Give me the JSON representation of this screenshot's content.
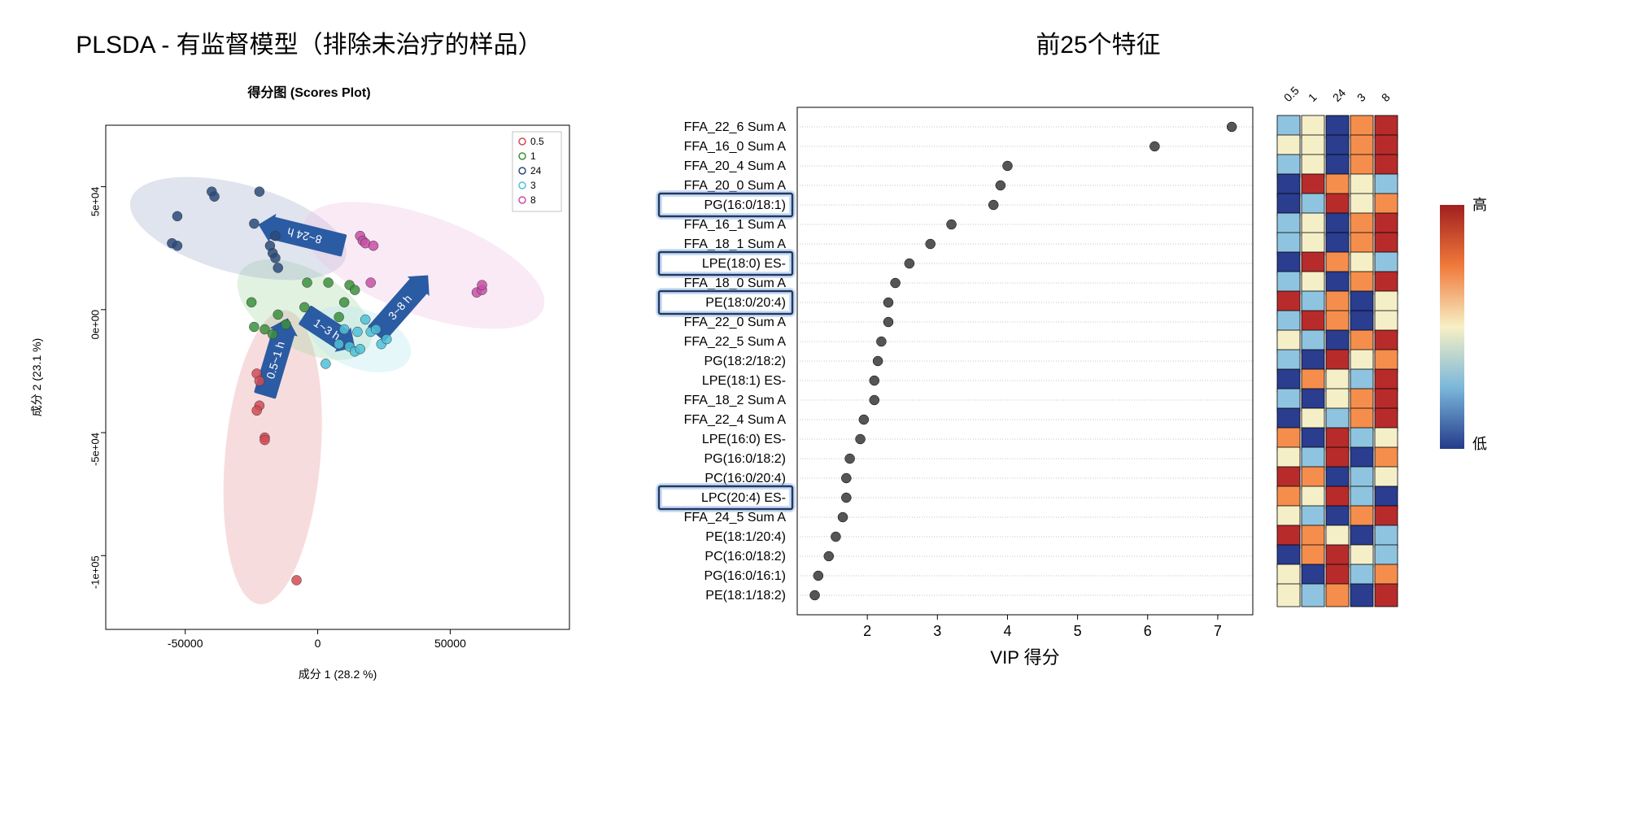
{
  "left": {
    "title": "PLSDA - 有监督模型（排除未治疗的样品）",
    "plot_title": "得分图 (Scores Plot)",
    "xlabel": "成分 1 (28.2 %)",
    "ylabel": "成分 2 (23.1 %)",
    "legend": [
      "0.5",
      "1",
      "24",
      "3",
      "8"
    ],
    "arrows": [
      "0.5~1 h",
      "1~3 h",
      "3~8 h",
      "8~24 h"
    ]
  },
  "right": {
    "title": "前25个特征",
    "xlabel": "VIP 得分",
    "heat_cols": [
      "0.5",
      "1",
      "24",
      "3",
      "8"
    ],
    "heat_high": "高",
    "heat_low": "低",
    "boxed_index": [
      4,
      7,
      9,
      19
    ]
  },
  "chart_data": [
    {
      "type": "scatter",
      "title": "得分图 (Scores Plot)",
      "xlabel": "成分 1 (28.2 %)",
      "ylabel": "成分 2 (23.1 %)",
      "xlim": [
        -80000,
        95000
      ],
      "ylim": [
        -130000,
        75000
      ],
      "xticks": [
        -50000,
        0,
        50000
      ],
      "yticks_labels": [
        "-1e+05",
        "-5e+04",
        "0e+00",
        "5e+04"
      ],
      "yticks": [
        -100000,
        -50000,
        0,
        50000
      ],
      "series": [
        {
          "name": "0.5",
          "color": "#d24b56",
          "points": [
            [
              -23000,
              -26000
            ],
            [
              -22000,
              -29000
            ],
            [
              -22000,
              -39000
            ],
            [
              -23000,
              -41000
            ],
            [
              -20000,
              -52000
            ],
            [
              -20000,
              -53000
            ],
            [
              -8000,
              -110000
            ]
          ]
        },
        {
          "name": "1",
          "color": "#3c8f3c",
          "points": [
            [
              -25000,
              3000
            ],
            [
              -24000,
              -7000
            ],
            [
              -20000,
              -8000
            ],
            [
              -17000,
              -10000
            ],
            [
              -15000,
              -2000
            ],
            [
              -12000,
              -6000
            ],
            [
              -5000,
              1000
            ],
            [
              -4000,
              11000
            ],
            [
              4000,
              11000
            ],
            [
              12000,
              10000
            ],
            [
              14000,
              8000
            ],
            [
              10000,
              3000
            ],
            [
              8000,
              -3000
            ]
          ]
        },
        {
          "name": "24",
          "color": "#2c4b7a",
          "points": [
            [
              -55000,
              27000
            ],
            [
              -53000,
              26000
            ],
            [
              -53000,
              38000
            ],
            [
              -40000,
              48000
            ],
            [
              -39000,
              46000
            ],
            [
              -22000,
              48000
            ],
            [
              -24000,
              35000
            ],
            [
              -18000,
              26000
            ],
            [
              -17000,
              23000
            ],
            [
              -16000,
              30000
            ],
            [
              -16000,
              21000
            ],
            [
              -15000,
              17000
            ]
          ]
        },
        {
          "name": "3",
          "color": "#4fc0d8",
          "points": [
            [
              3000,
              -22000
            ],
            [
              8000,
              -14000
            ],
            [
              10000,
              -8000
            ],
            [
              12000,
              -15000
            ],
            [
              14000,
              -17000
            ],
            [
              15000,
              -9000
            ],
            [
              16000,
              -16000
            ],
            [
              18000,
              -4000
            ],
            [
              20000,
              -9000
            ],
            [
              22000,
              -8000
            ],
            [
              24000,
              -14000
            ],
            [
              26000,
              -12000
            ]
          ]
        },
        {
          "name": "8",
          "color": "#c850a6",
          "points": [
            [
              16000,
              30000
            ],
            [
              17000,
              28000
            ],
            [
              18000,
              27000
            ],
            [
              21000,
              26000
            ],
            [
              20000,
              11000
            ],
            [
              60000,
              7000
            ],
            [
              62000,
              8000
            ],
            [
              62000,
              10000
            ]
          ]
        }
      ],
      "ellipses": [
        {
          "name": "0.5",
          "color": "#e99aa0",
          "cx": -17000,
          "cy": -60000,
          "rx": 18000,
          "ry": 60000,
          "angle": -5
        },
        {
          "name": "1",
          "color": "#a8d9a8",
          "cx": -5000,
          "cy": 0,
          "rx": 28000,
          "ry": 16000,
          "angle": -30
        },
        {
          "name": "24",
          "color": "#a3b2cf",
          "cx": -30000,
          "cy": 33000,
          "rx": 42000,
          "ry": 18000,
          "angle": -15
        },
        {
          "name": "3",
          "color": "#b8e8f0",
          "cx": 16000,
          "cy": -12000,
          "rx": 20000,
          "ry": 12000,
          "angle": -20
        },
        {
          "name": "8",
          "color": "#eec2e2",
          "cx": 40000,
          "cy": 18000,
          "rx": 48000,
          "ry": 20000,
          "angle": -20
        }
      ],
      "arrows": [
        {
          "label": "0.5~1 h",
          "x1": -20000,
          "y1": -35000,
          "x2": -12000,
          "y2": -6000
        },
        {
          "label": "1~3 h",
          "x1": -5000,
          "y1": -2000,
          "x2": 12000,
          "y2": -14000
        },
        {
          "label": "3~8 h",
          "x1": 22000,
          "y1": -10000,
          "x2": 40000,
          "y2": 12000
        },
        {
          "label": "8~24 h",
          "x1": 10000,
          "y1": 26000,
          "x2": -20000,
          "y2": 34000
        }
      ]
    },
    {
      "type": "dot-ranked",
      "xlabel": "VIP 得分",
      "xlim": [
        1,
        7.5
      ],
      "xticks": [
        2,
        3,
        4,
        5,
        6,
        7
      ],
      "features": [
        {
          "name": "FFA_22_6 Sum A",
          "vip": 7.2,
          "heat": [
            "lb",
            "cr",
            "db",
            "or",
            "rd"
          ]
        },
        {
          "name": "FFA_16_0 Sum A",
          "vip": 6.1,
          "heat": [
            "cr",
            "cr",
            "db",
            "or",
            "rd"
          ]
        },
        {
          "name": "FFA_20_4 Sum A",
          "vip": 4.0,
          "heat": [
            "lb",
            "cr",
            "db",
            "or",
            "rd"
          ]
        },
        {
          "name": "FFA_20_0 Sum A",
          "vip": 3.9,
          "heat": [
            "db",
            "rd",
            "or",
            "cr",
            "lb"
          ]
        },
        {
          "name": "PG(16:0/18:1)",
          "vip": 3.8,
          "heat": [
            "db",
            "lb",
            "rd",
            "cr",
            "or"
          ]
        },
        {
          "name": "FFA_16_1 Sum A",
          "vip": 3.2,
          "heat": [
            "lb",
            "cr",
            "db",
            "or",
            "rd"
          ]
        },
        {
          "name": "FFA_18_1 Sum A",
          "vip": 2.9,
          "heat": [
            "lb",
            "cr",
            "db",
            "or",
            "rd"
          ]
        },
        {
          "name": "LPE(18:0) ES-",
          "vip": 2.6,
          "heat": [
            "db",
            "rd",
            "or",
            "cr",
            "lb"
          ]
        },
        {
          "name": "FFA_18_0 Sum A",
          "vip": 2.4,
          "heat": [
            "lb",
            "cr",
            "db",
            "or",
            "rd"
          ]
        },
        {
          "name": "PE(18:0/20:4)",
          "vip": 2.3,
          "heat": [
            "rd",
            "lb",
            "or",
            "db",
            "cr"
          ]
        },
        {
          "name": "FFA_22_0 Sum A",
          "vip": 2.3,
          "heat": [
            "lb",
            "rd",
            "or",
            "db",
            "cr"
          ]
        },
        {
          "name": "FFA_22_5 Sum A",
          "vip": 2.2,
          "heat": [
            "cr",
            "lb",
            "db",
            "or",
            "rd"
          ]
        },
        {
          "name": "PG(18:2/18:2)",
          "vip": 2.15,
          "heat": [
            "lb",
            "db",
            "rd",
            "cr",
            "or"
          ]
        },
        {
          "name": "LPE(18:1) ES-",
          "vip": 2.1,
          "heat": [
            "db",
            "or",
            "cr",
            "lb",
            "rd"
          ]
        },
        {
          "name": "FFA_18_2 Sum A",
          "vip": 2.1,
          "heat": [
            "lb",
            "db",
            "cr",
            "or",
            "rd"
          ]
        },
        {
          "name": "FFA_22_4 Sum A",
          "vip": 1.95,
          "heat": [
            "db",
            "cr",
            "lb",
            "or",
            "rd"
          ]
        },
        {
          "name": "LPE(16:0) ES-",
          "vip": 1.9,
          "heat": [
            "or",
            "db",
            "rd",
            "lb",
            "cr"
          ]
        },
        {
          "name": "PG(16:0/18:2)",
          "vip": 1.75,
          "heat": [
            "cr",
            "lb",
            "rd",
            "db",
            "or"
          ]
        },
        {
          "name": "PC(16:0/20:4)",
          "vip": 1.7,
          "heat": [
            "rd",
            "or",
            "db",
            "lb",
            "cr"
          ]
        },
        {
          "name": "LPC(20:4) ES-",
          "vip": 1.7,
          "heat": [
            "or",
            "cr",
            "rd",
            "lb",
            "db"
          ]
        },
        {
          "name": "FFA_24_5 Sum A",
          "vip": 1.65,
          "heat": [
            "cr",
            "lb",
            "db",
            "or",
            "rd"
          ]
        },
        {
          "name": "PE(18:1/20:4)",
          "vip": 1.55,
          "heat": [
            "rd",
            "or",
            "cr",
            "db",
            "lb"
          ]
        },
        {
          "name": "PC(16:0/18:2)",
          "vip": 1.45,
          "heat": [
            "db",
            "or",
            "rd",
            "cr",
            "lb"
          ]
        },
        {
          "name": "PG(16:0/16:1)",
          "vip": 1.3,
          "heat": [
            "cr",
            "db",
            "rd",
            "lb",
            "or"
          ]
        },
        {
          "name": "PE(18:1/18:2)",
          "vip": 1.25,
          "heat": [
            "cr",
            "lb",
            "or",
            "db",
            "rd"
          ]
        }
      ]
    }
  ]
}
